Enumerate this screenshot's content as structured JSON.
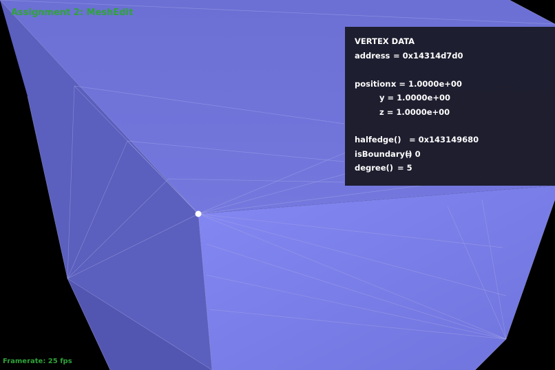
{
  "app": {
    "title": "Assignment 2: MeshEdit",
    "framerate": "Framerate: 25 fps"
  },
  "vertex_panel": {
    "heading": "VERTEX DATA",
    "address_label": "address",
    "address_value": "= 0x14314d7d0",
    "position_label": "position:",
    "pos_x": "x = 1.0000e+00",
    "pos_y": "y = 1.0000e+00",
    "pos_z": "z = 1.0000e+00",
    "halfedge_label": "halfedge()",
    "halfedge_value": "= 0x143149680",
    "isboundary_label": "isBoundary()",
    "isboundary_value": "= 0",
    "degree_label": "degree()",
    "degree_value": "= 5"
  },
  "colors": {
    "background": "#000000",
    "mesh_front": "#7d80ea",
    "mesh_side": "#5d61bf",
    "overlay_text": "#2fa33a",
    "selected_vertex": "#ffffff"
  }
}
